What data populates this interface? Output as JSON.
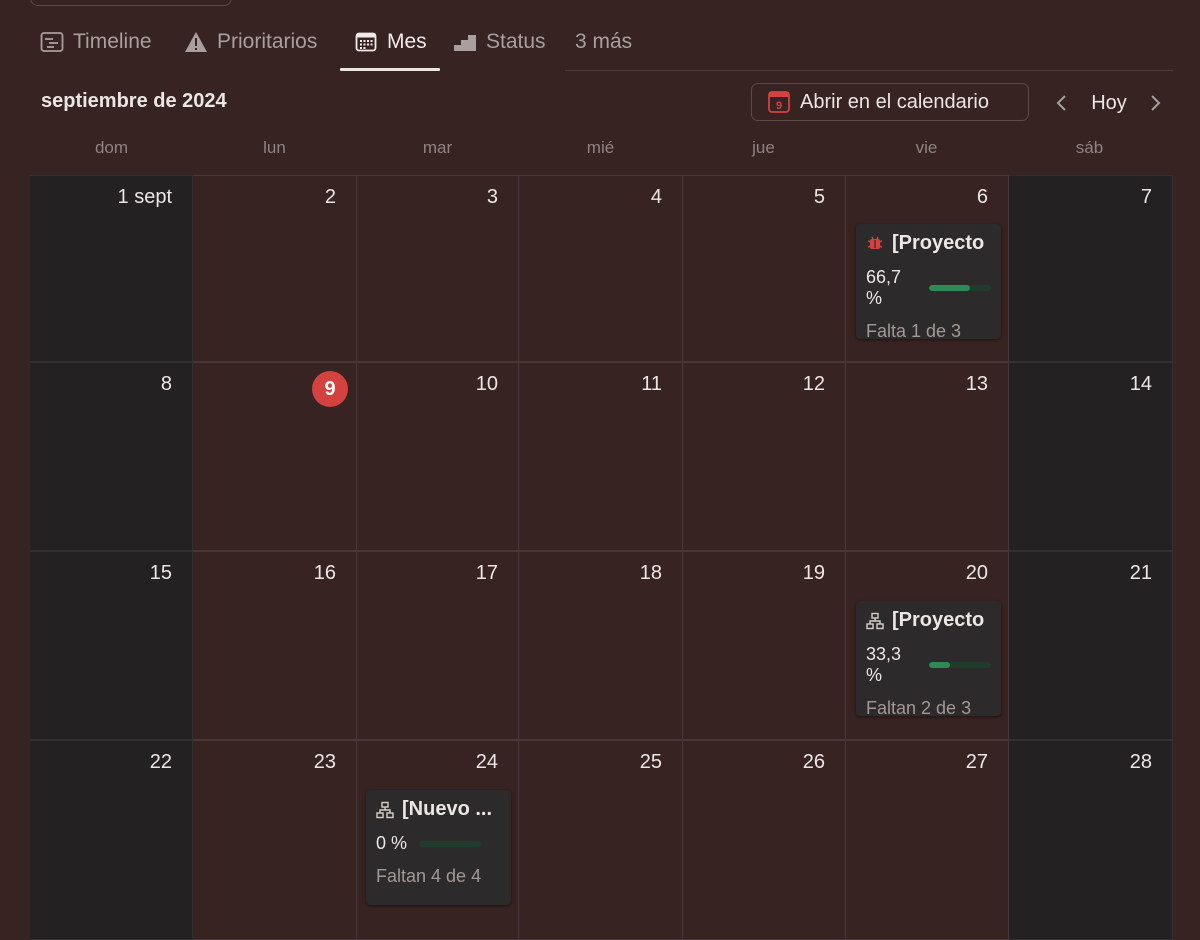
{
  "tabs": [
    {
      "label": "Timeline",
      "icon": "timeline-icon"
    },
    {
      "label": "Prioritarios",
      "icon": "warning-icon"
    },
    {
      "label": "Mes",
      "icon": "calendar-icon"
    },
    {
      "label": "Status",
      "icon": "bar-chart-icon"
    },
    {
      "label": "3 más"
    }
  ],
  "header": {
    "month_title": "septiembre de 2024",
    "open_calendar_label": "Abrir en el calendario",
    "open_calendar_icon_day": "9",
    "today_label": "Hoy"
  },
  "weekdays": [
    "dom",
    "lun",
    "mar",
    "mié",
    "jue",
    "vie",
    "sáb"
  ],
  "weeks": [
    [
      "1 sept",
      "2",
      "3",
      "4",
      "5",
      "6",
      "7"
    ],
    [
      "8",
      "9",
      "10",
      "11",
      "12",
      "13",
      "14"
    ],
    [
      "15",
      "16",
      "17",
      "18",
      "19",
      "20",
      "21"
    ],
    [
      "22",
      "23",
      "24",
      "25",
      "26",
      "27",
      "28"
    ]
  ],
  "today_label": "9",
  "cards": [
    {
      "title": "[Proyecto",
      "icon": "bug-icon",
      "progress_label": "66,7 %",
      "progress": 0.667,
      "remaining": "Falta 1 de 3"
    },
    {
      "title": "[Proyecto",
      "icon": "sitemap-icon",
      "progress_label": "33,3 %",
      "progress": 0.333,
      "remaining": "Faltan 2 de 3"
    },
    {
      "title": "[Nuevo ...",
      "icon": "sitemap-icon",
      "progress_label": "0 %",
      "progress": 0,
      "remaining": "Faltan 4 de 4"
    }
  ],
  "colors": {
    "background": "#362322",
    "weekend_background": "#232122",
    "today_badge": "#d3423f",
    "progress_fill": "#2e8a56",
    "progress_track": "#1f3b2c",
    "calendar_icon_red": "#d3423f"
  }
}
